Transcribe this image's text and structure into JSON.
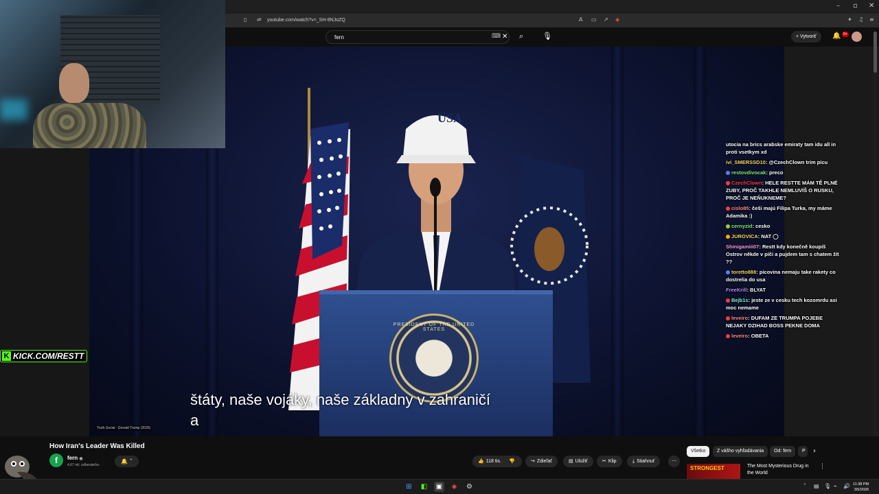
{
  "browser": {
    "url": "youtube.com/watch?v=_SH-8NJoZQ",
    "window_controls": [
      "–",
      "▫",
      "✕"
    ]
  },
  "youtube": {
    "search_value": "fern",
    "create_label": "Vytvoriť",
    "notif_count": "9+"
  },
  "video": {
    "subtitle_line1": "štáty, naše vojáky, naše základny v zahraničí",
    "subtitle_line2": "a",
    "watermark": "Truth Social - Donald Trump (2026)",
    "cap_text": "USA",
    "seal_text": "PRESIDENT OF THE UNITED STATES"
  },
  "kick_badge": "KICK.COM/RESTT",
  "chat": [
    {
      "user": "",
      "color": "#ffffff",
      "dot": "",
      "text": "utocia na brics arabske emiraty tam idu all in proti vsetkym xd"
    },
    {
      "user": "ivi_SMERSSD10",
      "color": "#f6d365",
      "dot": "",
      "text": "@CzechClown trim picu"
    },
    {
      "user": "restovdivocak",
      "color": "#7cf27c",
      "dot": "#5a7dff",
      "text": "preco"
    },
    {
      "user": "CzechClown",
      "color": "#ff3b3b",
      "dot": "#ff3b3b",
      "text": "HELE RESTTE MÁM TĚ PLNÉ ZUBY, PROČ TAKHLE NEMLUVÍŠ O RUSKU, PROČ JE NEŇUKNEME?"
    },
    {
      "user": "cislo85",
      "color": "#ff8c8c",
      "dot": "#ff3b3b",
      "text": "češi majú Filipa Turka, my máme Adamika :)"
    },
    {
      "user": "cernyzid",
      "color": "#7cf27c",
      "dot": "#9acd32",
      "text": "cesko"
    },
    {
      "user": "JUROVICA",
      "color": "#f6d365",
      "dot": "#ffb000",
      "text": "NAT ◯"
    },
    {
      "user": "Shinigamiii07",
      "color": "#ff9be0",
      "dot": "",
      "text": "Restt kdy konečně koupíš Ostrov někde v píči a pujdem tam s chatem žít ??"
    },
    {
      "user": "toretto888",
      "color": "#f6d365",
      "dot": "#5a7dff",
      "text": "picovina nemaju take rakety co dostrelia do usa"
    },
    {
      "user": "FreeKrill",
      "color": "#b98cff",
      "dot": "",
      "text": "BLYAT"
    },
    {
      "user": "Bejb1s",
      "color": "#7cf2e0",
      "dot": "#ff3b3b",
      "text": "jeste ze v cesku tech kozomrdu asi moc nemame"
    },
    {
      "user": "leveiro",
      "color": "#ff8c8c",
      "dot": "#ff3b3b",
      "text": "DUFAM ZE TRUMPA POJEBE NEJAKY DZIHAD BOSS PEKNE DOMA"
    },
    {
      "user": "leveiro",
      "color": "#ff8c8c",
      "dot": "#ff3b3b",
      "text": "OBETA"
    }
  ],
  "below": {
    "title": "How Iran's Leader Was Killed",
    "channel_name": "fern",
    "channel_initial": "f",
    "subscribers": "4,67 mil. odberateľov",
    "likes": "118 tis.",
    "share_label": "Zdieľať",
    "save_label": "Uložiť",
    "clip_label": "Klip",
    "download_label": "Stiahnuť",
    "chips": [
      "Všetko",
      "Z vášho vyhľadávania",
      "Od: fern",
      "P"
    ],
    "rec_thumb_text": "STRONGEST",
    "rec_title": "The Most Mysterious Drug in the World"
  },
  "taskbar": {
    "time": "11:38 PM",
    "date": "3/5/2026"
  }
}
